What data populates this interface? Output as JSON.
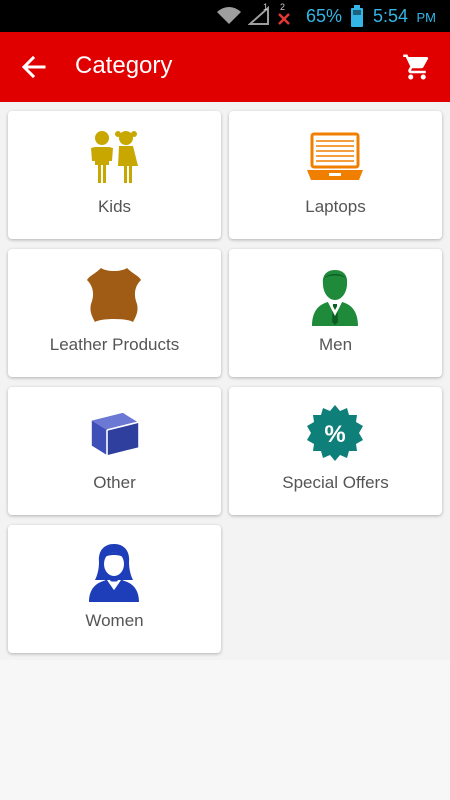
{
  "status_bar": {
    "battery_percent": "65%",
    "time": "5:54",
    "ampm": "PM",
    "sim_badge": "2",
    "sim_badge2": "1"
  },
  "app_bar": {
    "title": "Category",
    "background": "#e10000"
  },
  "categories": [
    {
      "label": "Kids",
      "icon": "kids-icon",
      "color": "#c8a800"
    },
    {
      "label": "Laptops",
      "icon": "laptop-icon",
      "color": "#f07f00"
    },
    {
      "label": "Leather Products",
      "icon": "leather-icon",
      "color": "#a05c14"
    },
    {
      "label": "Men",
      "icon": "man-icon",
      "color": "#1f8a3a"
    },
    {
      "label": "Other",
      "icon": "box-icon",
      "color": "#3e4fb8"
    },
    {
      "label": "Special Offers",
      "icon": "discount-badge-icon",
      "color": "#0f7f7a"
    },
    {
      "label": "Women",
      "icon": "woman-icon",
      "color": "#1d3eb8"
    }
  ]
}
